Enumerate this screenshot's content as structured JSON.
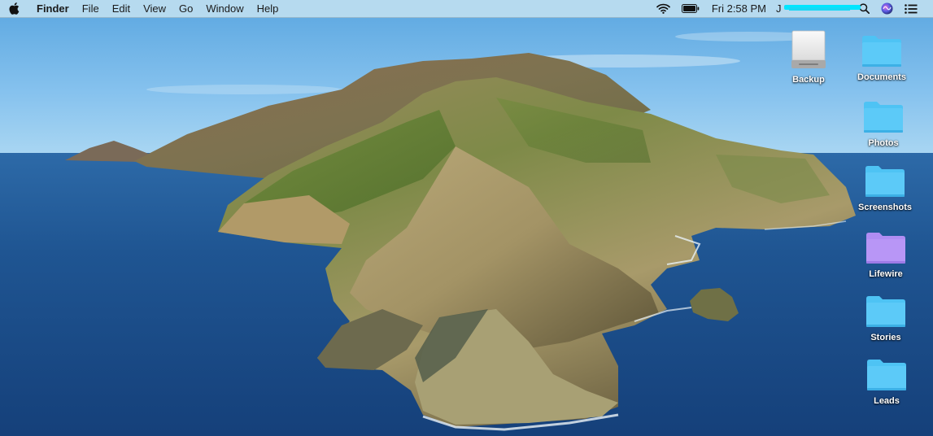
{
  "menubar": {
    "apple_icon": "apple-logo-icon",
    "app_name": "Finder",
    "menus": [
      "File",
      "Edit",
      "View",
      "Go",
      "Window",
      "Help"
    ],
    "status": {
      "wifi_icon": "wifi-icon",
      "battery_icon": "battery-icon",
      "clock": "Fri 2:58 PM",
      "user_name_visible": "J",
      "user_name_redacted": true,
      "spotlight_icon": "spotlight-search-icon",
      "siri_icon": "siri-icon",
      "notification_center_icon": "notification-center-icon"
    }
  },
  "desktop": {
    "wallpaper": "macOS Catalina island coastline",
    "colors": {
      "folder_blue": "#4fc3f7",
      "folder_purple": "#b292f5",
      "sky": "#8ec7ec",
      "ocean": "#1e4f86"
    },
    "icons": [
      {
        "label": "Backup",
        "type": "drive"
      },
      {
        "label": "Documents",
        "type": "folder",
        "color": "blue"
      },
      {
        "label": "Photos",
        "type": "folder",
        "color": "blue"
      },
      {
        "label": "Screenshots",
        "type": "folder",
        "color": "blue"
      },
      {
        "label": "Lifewire",
        "type": "folder",
        "color": "purple"
      },
      {
        "label": "Stories",
        "type": "folder",
        "color": "blue"
      },
      {
        "label": "Leads",
        "type": "folder",
        "color": "blue"
      }
    ]
  }
}
